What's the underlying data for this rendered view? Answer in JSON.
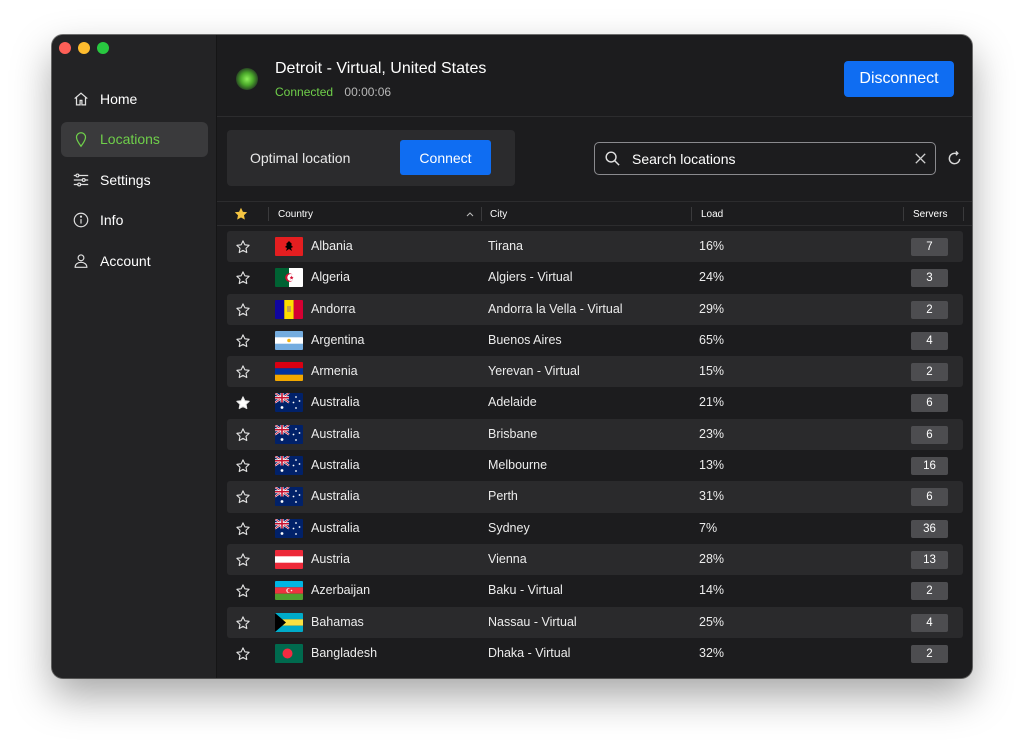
{
  "nav": {
    "items": [
      {
        "label": "Home",
        "icon": "home-icon"
      },
      {
        "label": "Locations",
        "icon": "location-pin-icon"
      },
      {
        "label": "Settings",
        "icon": "sliders-icon"
      },
      {
        "label": "Info",
        "icon": "info-icon"
      },
      {
        "label": "Account",
        "icon": "user-icon"
      }
    ],
    "active": "Locations"
  },
  "header": {
    "location": "Detroit - Virtual, United States",
    "status": "Connected",
    "elapsed": "00:00:06",
    "disconnect_label": "Disconnect"
  },
  "optimal": {
    "label": "Optimal location",
    "connect_label": "Connect"
  },
  "search": {
    "placeholder": "Search locations"
  },
  "table": {
    "headers": {
      "country": "Country",
      "city": "City",
      "load": "Load",
      "servers": "Servers"
    },
    "rows": [
      {
        "favorite": false,
        "flag": "albania",
        "country": "Albania",
        "city": "Tirana",
        "load": "16%",
        "servers": "7"
      },
      {
        "favorite": false,
        "flag": "algeria",
        "country": "Algeria",
        "city": "Algiers - Virtual",
        "load": "24%",
        "servers": "3"
      },
      {
        "favorite": false,
        "flag": "andorra",
        "country": "Andorra",
        "city": "Andorra la Vella - Virtual",
        "load": "29%",
        "servers": "2"
      },
      {
        "favorite": false,
        "flag": "argentina",
        "country": "Argentina",
        "city": "Buenos Aires",
        "load": "65%",
        "servers": "4"
      },
      {
        "favorite": false,
        "flag": "armenia",
        "country": "Armenia",
        "city": "Yerevan - Virtual",
        "load": "15%",
        "servers": "2"
      },
      {
        "favorite": true,
        "flag": "australia",
        "country": "Australia",
        "city": "Adelaide",
        "load": "21%",
        "servers": "6"
      },
      {
        "favorite": false,
        "flag": "australia",
        "country": "Australia",
        "city": "Brisbane",
        "load": "23%",
        "servers": "6"
      },
      {
        "favorite": false,
        "flag": "australia",
        "country": "Australia",
        "city": "Melbourne",
        "load": "13%",
        "servers": "16"
      },
      {
        "favorite": false,
        "flag": "australia",
        "country": "Australia",
        "city": "Perth",
        "load": "31%",
        "servers": "6"
      },
      {
        "favorite": false,
        "flag": "australia",
        "country": "Australia",
        "city": "Sydney",
        "load": "7%",
        "servers": "36"
      },
      {
        "favorite": false,
        "flag": "austria",
        "country": "Austria",
        "city": "Vienna",
        "load": "28%",
        "servers": "13"
      },
      {
        "favorite": false,
        "flag": "azerbaijan",
        "country": "Azerbaijan",
        "city": "Baku - Virtual",
        "load": "14%",
        "servers": "2"
      },
      {
        "favorite": false,
        "flag": "bahamas",
        "country": "Bahamas",
        "city": "Nassau - Virtual",
        "load": "25%",
        "servers": "4"
      },
      {
        "favorite": false,
        "flag": "bangladesh",
        "country": "Bangladesh",
        "city": "Dhaka - Virtual",
        "load": "32%",
        "servers": "2"
      }
    ]
  },
  "colors": {
    "accent_blue": "#0f6df2",
    "connected_green": "#6fcf4a",
    "favorite_star": "#f5c542"
  }
}
